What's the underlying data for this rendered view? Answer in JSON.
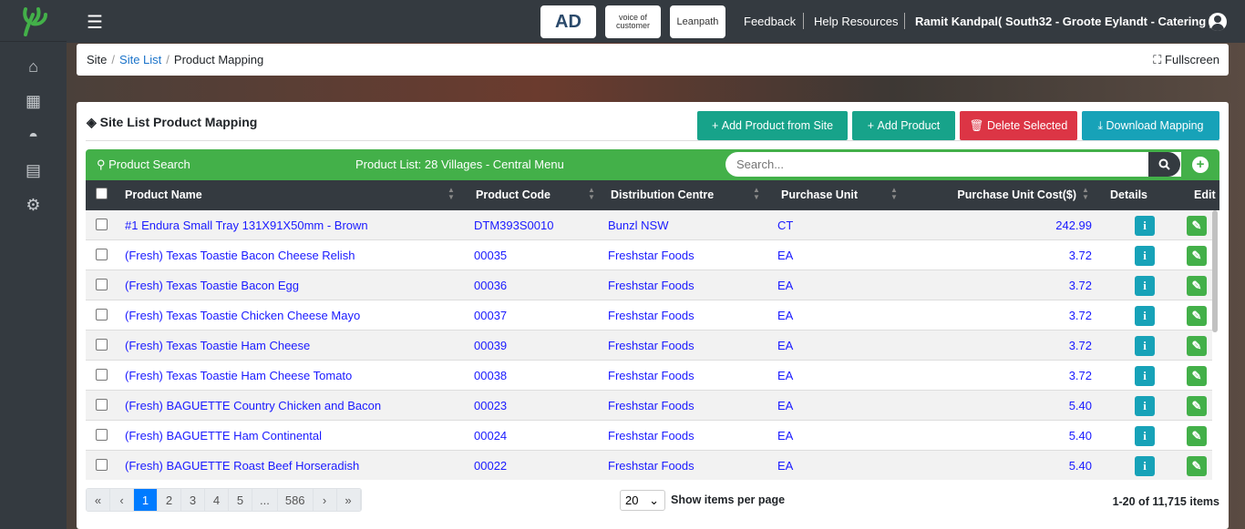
{
  "header": {
    "menu_icon": "hamburger-icon",
    "brands": [
      "AD",
      "voice of customer",
      "Leanpath"
    ],
    "links": [
      "Feedback",
      "Help Resources"
    ],
    "user": "Ramit Kandpal( South32 - Groote Eylandt - Catering )"
  },
  "sidebar": {
    "items": [
      "home-icon",
      "boxes-icon",
      "food-bowl-icon",
      "table-icon",
      "gear-icon"
    ]
  },
  "breadcrumb": {
    "items": [
      "Site",
      "Site List",
      "Product Mapping"
    ],
    "fullscreen": "Fullscreen"
  },
  "card": {
    "title": "Site List Product Mapping",
    "buttons": {
      "add_from_site": "Add Product from Site",
      "add_product": "Add Product",
      "delete": "Delete Selected",
      "download": "Download Mapping"
    }
  },
  "toolbar": {
    "search_label": "Product Search",
    "list_label": "Product List: 28 Villages - Central Menu",
    "search_placeholder": "Search..."
  },
  "table": {
    "columns": [
      "Product Name",
      "Product Code",
      "Distribution Centre",
      "Purchase Unit",
      "Purchase Unit Cost($)",
      "Details",
      "Edit"
    ],
    "rows": [
      [
        "#1 Endura Small Tray 131X91X50mm - Brown",
        "DTM393S0010",
        "Bunzl NSW",
        "CT",
        "242.99"
      ],
      [
        "(Fresh) Texas Toastie Bacon Cheese Relish",
        "00035",
        "Freshstar Foods",
        "EA",
        "3.72"
      ],
      [
        "(Fresh) Texas Toastie Bacon Egg",
        "00036",
        "Freshstar Foods",
        "EA",
        "3.72"
      ],
      [
        "(Fresh) Texas Toastie Chicken Cheese Mayo",
        "00037",
        "Freshstar Foods",
        "EA",
        "3.72"
      ],
      [
        "(Fresh) Texas Toastie Ham Cheese",
        "00039",
        "Freshstar Foods",
        "EA",
        "3.72"
      ],
      [
        "(Fresh) Texas Toastie Ham Cheese Tomato",
        "00038",
        "Freshstar Foods",
        "EA",
        "3.72"
      ],
      [
        "(Fresh) BAGUETTE Country Chicken and Bacon",
        "00023",
        "Freshstar Foods",
        "EA",
        "5.40"
      ],
      [
        "(Fresh) BAGUETTE Ham Continental",
        "00024",
        "Freshstar Foods",
        "EA",
        "5.40"
      ],
      [
        "(Fresh) BAGUETTE Roast Beef Horseradish",
        "00022",
        "Freshstar Foods",
        "EA",
        "5.40"
      ]
    ]
  },
  "pagination": {
    "pages": [
      "«",
      "‹",
      "1",
      "2",
      "3",
      "4",
      "5",
      "...",
      "586",
      "›",
      "»"
    ],
    "current": "1",
    "per_page": "20",
    "per_page_label": "Show items per page",
    "count": "1-20 of 11,715 items"
  },
  "colors": {
    "green": "#43b049",
    "teal": "#17a38a",
    "red": "#dc3545",
    "info": "#17a2b8",
    "dark": "#343a40"
  }
}
